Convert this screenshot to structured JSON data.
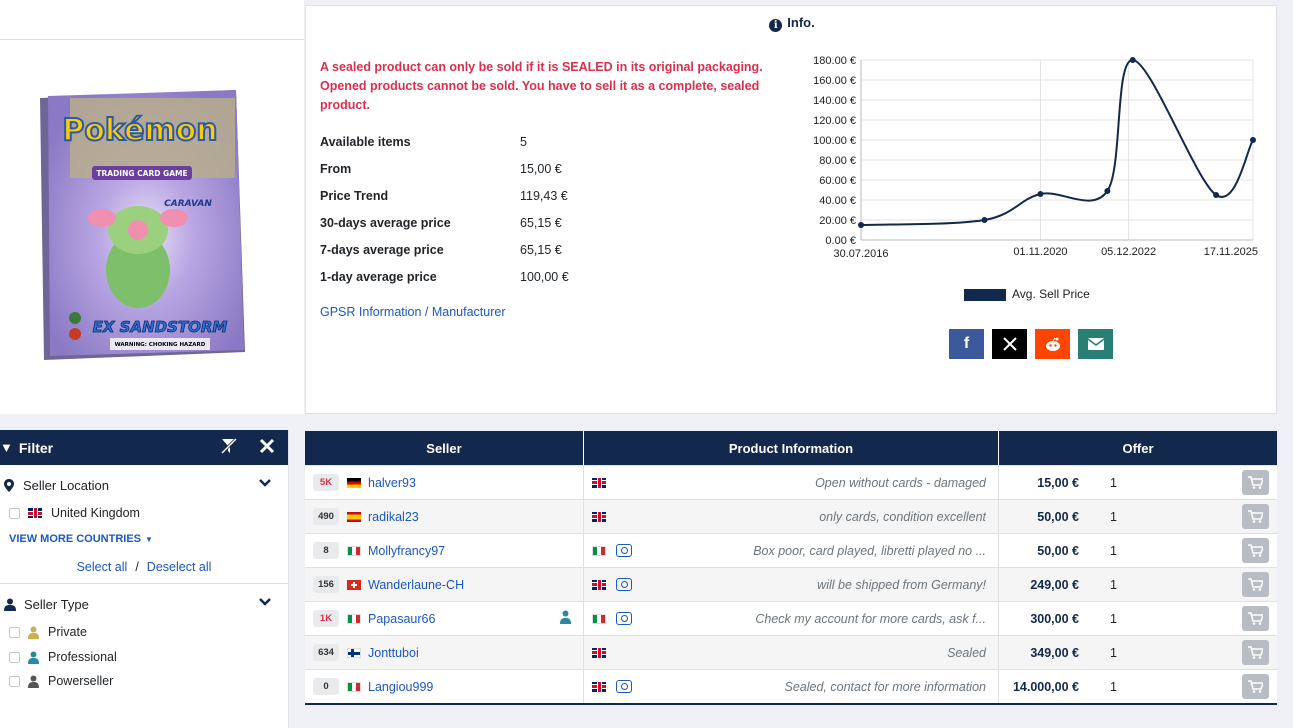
{
  "info": {
    "title": "Info.",
    "warning": "A sealed product can only be sold if it is SEALED in its original packaging. Opened products cannot be sold. You have to sell it as a complete, sealed product.",
    "stats": [
      {
        "label": "Available items",
        "value": "5"
      },
      {
        "label": "From",
        "value": "15,00 €"
      },
      {
        "label": "Price Trend",
        "value": "119,43 €"
      },
      {
        "label": "30-days average price",
        "value": "65,15 €"
      },
      {
        "label": "7-days average price",
        "value": "65,15 €"
      },
      {
        "label": "1-day average price",
        "value": "100,00 €"
      }
    ],
    "gpsr_link": "GPSR Information / Manufacturer"
  },
  "product": {
    "brand": "Pokémon",
    "subtitle": "TRADING CARD GAME",
    "deck_name": "CARAVAN",
    "set_name": "EX SANDSTORM",
    "warning_text": "WARNING: CHOKING HAZARD"
  },
  "chart_data": {
    "type": "line",
    "x": [
      "30.07.2016",
      "05.07.2019",
      "01.11.2020",
      "04.06.2022",
      "05.12.2022",
      "17.11.2025"
    ],
    "x_tick_labels": [
      "30.07.2016",
      "01.11.2020",
      "05.12.2022",
      "17.11.2025"
    ],
    "y_tick_labels": [
      "0.00 €",
      "20.00 €",
      "40.00 €",
      "60.00 €",
      "80.00 €",
      "100.00 €",
      "120.00 €",
      "140.00 €",
      "160.00 €",
      "180.00 €"
    ],
    "points": [
      {
        "x": "30.07.2016",
        "y": 15
      },
      {
        "x": "05.07.2019",
        "y": 20
      },
      {
        "x": "01.11.2020",
        "y": 46
      },
      {
        "x": "04.06.2022",
        "y": 49
      },
      {
        "x": "10.01.2023",
        "y": 180
      },
      {
        "x": "01.01.2025",
        "y": 45
      },
      {
        "x": "17.11.2025",
        "y": 100
      }
    ],
    "ylim": [
      0,
      180
    ],
    "legend": "Avg. Sell Price",
    "grid": true,
    "line_color": "#12284c"
  },
  "share": [
    {
      "name": "facebook",
      "color": "#3b5998"
    },
    {
      "name": "x",
      "color": "#000000"
    },
    {
      "name": "reddit",
      "color": "#ff4500"
    },
    {
      "name": "email",
      "color": "#2a7f75"
    }
  ],
  "filter": {
    "title": "Filter",
    "location_title": "Seller Location",
    "location_option": "United Kingdom",
    "view_more": "VIEW MORE COUNTRIES",
    "select_all": "Select all",
    "sep": "/",
    "deselect_all": "Deselect all",
    "type_title": "Seller Type",
    "types": [
      "Private",
      "Professional",
      "Powerseller"
    ]
  },
  "table": {
    "headers": [
      "Seller",
      "Product Information",
      "Offer"
    ],
    "rows": [
      {
        "badge": "5K",
        "flag": "de",
        "seller": "halver93",
        "pro": false,
        "lang": "gb",
        "camera": false,
        "comment": "Open without cards - damaged",
        "price": "15,00 €",
        "qty": "1"
      },
      {
        "badge": "490",
        "flag": "es",
        "seller": "radikal23",
        "pro": false,
        "lang": "gb",
        "camera": false,
        "comment": "only cards, condition excellent",
        "price": "50,00 €",
        "qty": "1"
      },
      {
        "badge": "8",
        "flag": "it",
        "seller": "Mollyfrancy97",
        "pro": false,
        "lang": "it",
        "camera": true,
        "comment": "Box poor, card played, libretti played no ...",
        "price": "50,00 €",
        "qty": "1"
      },
      {
        "badge": "156",
        "flag": "ch",
        "seller": "Wanderlaune-CH",
        "pro": false,
        "lang": "gb",
        "camera": true,
        "comment": "will be shipped from Germany!",
        "price": "249,00 €",
        "qty": "1"
      },
      {
        "badge": "1K",
        "flag": "it",
        "seller": "Papasaur66",
        "pro": true,
        "lang": "it",
        "camera": true,
        "comment": "Check my account for more cards, ask f...",
        "price": "300,00 €",
        "qty": "1"
      },
      {
        "badge": "634",
        "flag": "fi",
        "seller": "Jonttuboi",
        "pro": false,
        "lang": "gb",
        "camera": false,
        "comment": "Sealed",
        "price": "349,00 €",
        "qty": "1"
      },
      {
        "badge": "0",
        "flag": "it",
        "seller": "Langiou999",
        "pro": false,
        "lang": "gb",
        "camera": true,
        "comment": "Sealed, contact for more information",
        "price": "14.000,00 €",
        "qty": "1"
      }
    ]
  }
}
